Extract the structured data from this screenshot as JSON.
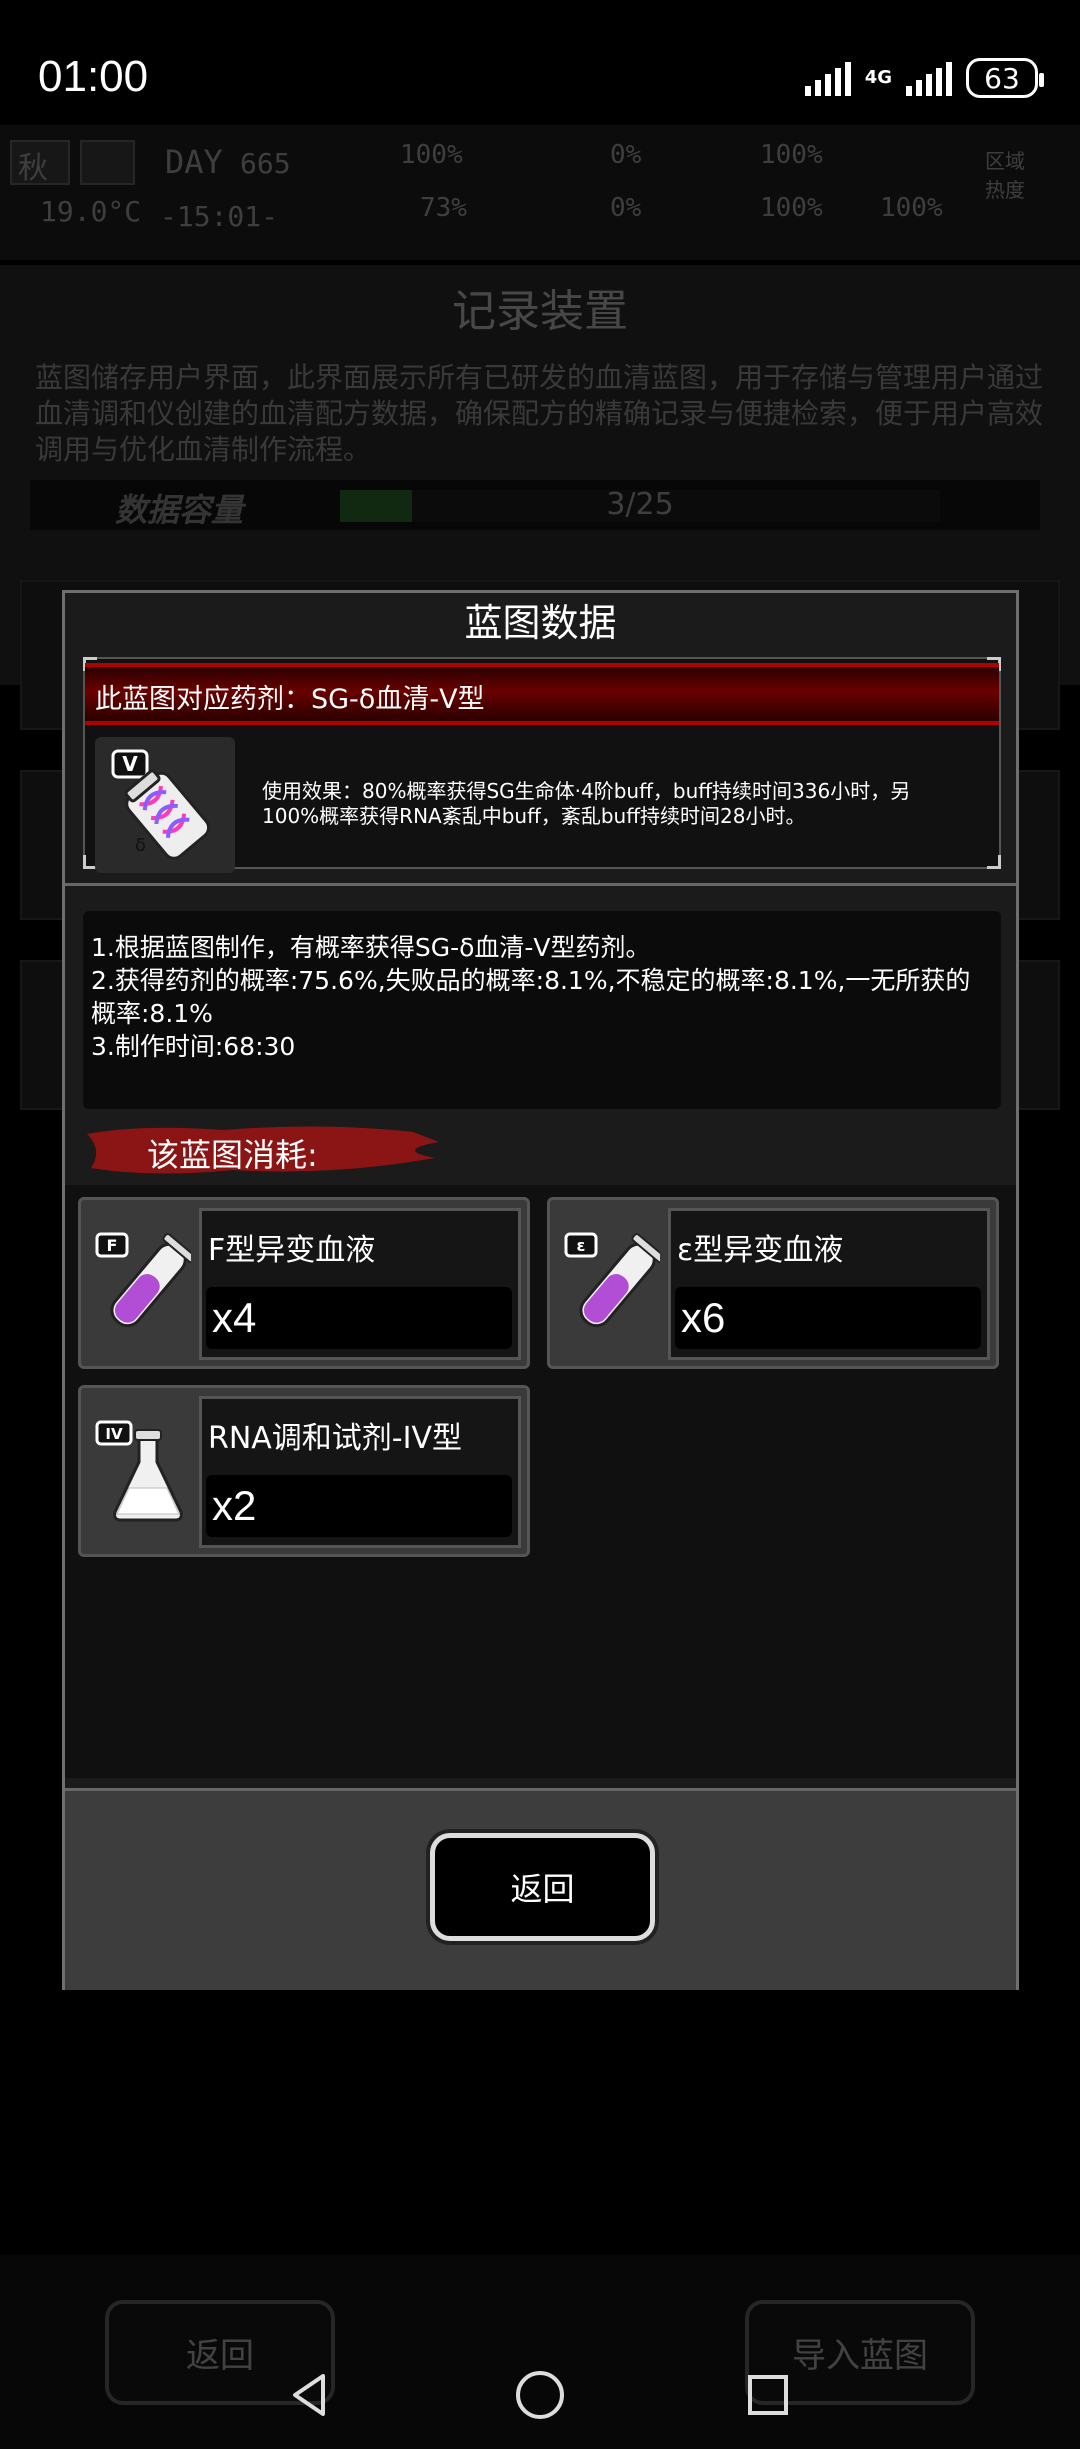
{
  "status_bar": {
    "time": "01:00",
    "network": "4G",
    "battery": "63"
  },
  "hud": {
    "season": "秋",
    "day_label": "DAY",
    "day_value": "665",
    "temperature": "19.0°C",
    "clock": "-15:01-",
    "stats": [
      "100%",
      "0%",
      "100%",
      "73%",
      "0%",
      "100%",
      "100%"
    ],
    "zone_heat": "区域热度"
  },
  "background_screen": {
    "title": "记录装置",
    "description": "蓝图储存用户界面，此界面展示所有已研发的血清蓝图，用于存储与管理用户通过血清调和仪创建的血清配方数据，确保配方的精确记录与便捷检索，便于用户高效调用与优化血清制作流程。",
    "capacity_label": "数据容量",
    "capacity_value": "3/25",
    "capacity_fraction": 0.12,
    "back_label": "返回",
    "import_label": "导入蓝图"
  },
  "modal": {
    "title": "蓝图数据",
    "drug_header": "此蓝图对应药剂：SG-δ血清-V型",
    "drug_icon_badge": "V",
    "drug_effect": "使用效果：80%概率获得SG生命体·4阶buff，buff持续时间336小时，另100%概率获得RNA紊乱中buff，紊乱buff持续时间28小时。",
    "rules": [
      "1.根据蓝图制作，有概率获得SG-δ血清-V型药剂。",
      "2.获得药剂的概率:75.6%,失败品的概率:8.1%,不稳定的概率:8.1%,一无所获的概率:8.1%",
      "3.制作时间:68:30"
    ],
    "consume_label": "该蓝图消耗:",
    "materials": [
      {
        "badge": "F",
        "name": "F型异变血液",
        "qty": "x4",
        "icon": "test-tube-icon"
      },
      {
        "badge": "ε",
        "name": "ε型异变血液",
        "qty": "x6",
        "icon": "test-tube-icon"
      },
      {
        "badge": "IV",
        "name": "RNA调和试剂-IV型",
        "qty": "x2",
        "icon": "flask-icon"
      }
    ],
    "back_label": "返回"
  },
  "colors": {
    "accent_red": "#b00000",
    "liquid_purple": "#b24ed6",
    "panel": "#3a3a3a"
  }
}
